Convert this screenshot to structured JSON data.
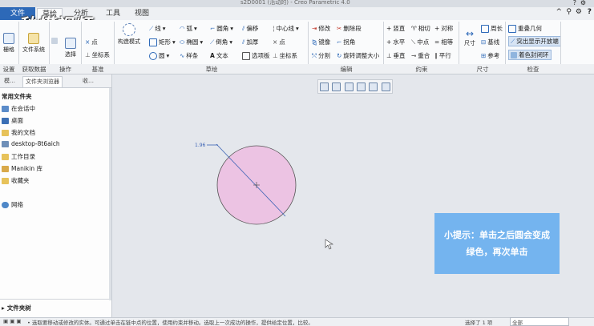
{
  "titlebar": {
    "title": "s2D0001 (活动的) - Creo Parametric 4.0"
  },
  "tabs": [
    "文件",
    "草绘",
    "分析",
    "工具",
    "视图"
  ],
  "watermark": "秒懂视频",
  "ribbon": {
    "groups": {
      "settings": "设置",
      "get_data": "获取数据",
      "operations": "操作",
      "datum": "基准",
      "sketch": "草绘",
      "edit": "编辑",
      "constrain": "约束",
      "dimension": "尺寸",
      "inspect": "检查"
    },
    "grid": "栅格",
    "file_system": "文件系统",
    "select": "选择",
    "point": "点",
    "coord_system": "坐标系",
    "construct_mode": "构造模式",
    "line": "线",
    "arc": "弧",
    "fillet": "圆角",
    "offset": "偏移",
    "centerline": "中心线",
    "rectangle": "矩形",
    "ellipse": "椭圆",
    "chamfer": "倒角",
    "thicken": "加厚",
    "point2": "点",
    "circle": "圆",
    "spline": "样条",
    "text": "文本",
    "palette": "选项板",
    "coord2": "坐标系",
    "modify": "修改",
    "delete_segment": "删除段",
    "mirror": "镜像",
    "corner": "拐角",
    "divide": "分割",
    "rotate_resize": "旋转调整大小",
    "vertical": "竖直",
    "tangent": "相切",
    "symmetric": "对称",
    "horizontal": "水平",
    "midpoint": "中点",
    "equal": "相等",
    "perpendicular": "垂直",
    "coincident": "重合",
    "parallel": "平行",
    "dimension_btn": "尺寸",
    "perimeter": "周长",
    "baseline": "基线",
    "reference": "参考",
    "overlap_geometry": "重叠几何",
    "highlight_open_ends": "突出显示开放端",
    "shade_closed_loops": "着色封闭环"
  },
  "leftpanel": {
    "tabs": [
      "模…",
      "文件夹浏览器",
      "收…"
    ],
    "section_title": "常用文件夹",
    "items": [
      "在会话中",
      "桌面",
      "我的文档",
      "desktop-8t6aich",
      "工作目录",
      "Manikin 库",
      "收藏夹"
    ],
    "network": "网络",
    "tree_footer": "文件夹树"
  },
  "canvas": {
    "dim_label": "1.96",
    "circle_color": "#ecc3e3",
    "tip_lines": [
      "小提示：单击之后圆会变成",
      "绿色，再次单击"
    ]
  },
  "statusbar": {
    "message": "• 选取要移动或修改的实体。可通过单击在链中点的位置，使用约束并移动。选取上一次成功的操作，提供给定位置，比较。",
    "filter": "选择了 1 项",
    "filter_value": "全部"
  },
  "colors": {
    "accent": "#2d69b8",
    "tip_bg": "#74b4ef",
    "circle_fill": "#ecc3e3"
  }
}
